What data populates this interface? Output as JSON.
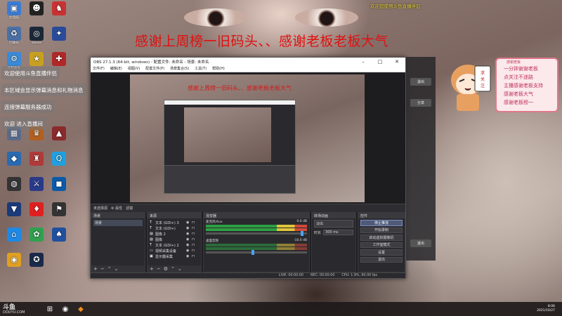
{
  "banner": "感谢上周榜一旧码头、、感谢老板老板大气",
  "notice": "欢迎您使用斗鱼直播伴侣",
  "chat_messages": [
    "欢迎使用斗鱼直播伴侣",
    "本区域会显示弹幕消息和礼物消息",
    "连接弹幕服务器成功",
    "欢迎 进入直播间"
  ],
  "desktop_icons": [
    {
      "label": "此电脑",
      "color": "#3a7bd5",
      "glyph": "▣"
    },
    {
      "label": "",
      "color": "#222",
      "glyph": "☻"
    },
    {
      "label": "",
      "color": "#c83232",
      "glyph": "♞"
    },
    {
      "label": "回收站",
      "color": "#4a6fa5",
      "glyph": "♻"
    },
    {
      "label": "Steam",
      "color": "#1b2838",
      "glyph": "◎"
    },
    {
      "label": "",
      "color": "#2a4a9a",
      "glyph": "✦"
    },
    {
      "label": "控制面板",
      "color": "#3a8ad6",
      "glyph": "⚙"
    },
    {
      "label": "",
      "color": "#c8a020",
      "glyph": "★"
    },
    {
      "label": "",
      "color": "#b02828",
      "glyph": "✚"
    },
    {
      "label": "",
      "color": "#5a6a8a",
      "glyph": "▦"
    },
    {
      "label": "",
      "color": "#b06020",
      "glyph": "♛"
    },
    {
      "label": "",
      "color": "#8a2a2a",
      "glyph": "▲"
    },
    {
      "label": "",
      "color": "#2a6ab0",
      "glyph": "◆"
    },
    {
      "label": "",
      "color": "#b03a3a",
      "glyph": "♜"
    },
    {
      "label": "",
      "color": "#20a0e0",
      "glyph": "Q"
    },
    {
      "label": "",
      "color": "#333",
      "glyph": "◍"
    },
    {
      "label": "",
      "color": "#2a3a8a",
      "glyph": "⚔"
    },
    {
      "label": "",
      "color": "#0a5aa8",
      "glyph": "◼"
    },
    {
      "label": "",
      "color": "#1a3a7a",
      "glyph": "▼"
    },
    {
      "label": "",
      "color": "#e02020",
      "glyph": "♦"
    },
    {
      "label": "",
      "color": "#333",
      "glyph": "⚑"
    },
    {
      "label": "",
      "color": "#1e88e5",
      "glyph": "⌂"
    },
    {
      "label": "",
      "color": "#30a050",
      "glyph": "✿"
    },
    {
      "label": "",
      "color": "#2050a0",
      "glyph": "♠"
    },
    {
      "label": "",
      "color": "#e0a020",
      "glyph": "◉"
    },
    {
      "label": "",
      "color": "#1a2a4a",
      "glyph": "✪"
    }
  ],
  "obs": {
    "title": "OBS 27.1.3 (64-bit, windows) - 配置文件: 未命名 - 场景: 未命名",
    "menu": [
      "文件(F)",
      "编辑(E)",
      "视图(V)",
      "配置文件(P)",
      "场景集合(S)",
      "工具(T)",
      "帮助(H)"
    ],
    "toolbar": [
      "未选择源",
      "⚙ 属性",
      "滤镜"
    ],
    "preview_banner": "感谢上周榜一旧码头、、感谢老板老板大气",
    "docks": {
      "scenes": {
        "title": "场景",
        "items": [
          "场景"
        ]
      },
      "sources": {
        "title": "来源",
        "items": [
          {
            "icon": "T",
            "label": "文本 (GDI+) 3"
          },
          {
            "icon": "T",
            "label": "文本 (GDI+)"
          },
          {
            "icon": "▨",
            "label": "图像 2"
          },
          {
            "icon": "▨",
            "label": "图像"
          },
          {
            "icon": "T",
            "label": "文本 (GDI+) 2"
          },
          {
            "icon": "▭",
            "label": "视频采集设备"
          },
          {
            "icon": "▣",
            "label": "显示器采集"
          }
        ]
      },
      "mixer": {
        "title": "混音器",
        "tracks": [
          {
            "name": "麦克风/Aux",
            "db": "0.0 dB"
          },
          {
            "name": "桌面音频",
            "db": "-10.0 dB"
          }
        ]
      },
      "transitions": {
        "title": "转场动画",
        "type": "淡出",
        "duration_label": "时长",
        "duration": "300 ms"
      },
      "controls": {
        "title": "控件",
        "buttons": [
          "停止推流",
          "开始录制",
          "启动虚拟摄像机",
          "工作室模式",
          "设置",
          "退出"
        ]
      }
    },
    "status": {
      "live": "LIVE: 00:00:00",
      "rec": "REC: 00:00:00",
      "cpu": "CPU: 1.9%, 60.00 fps"
    }
  },
  "right_app": {
    "buttons": [
      "退出",
      "分享",
      "退出"
    ]
  },
  "sign": {
    "title": "感谢老板",
    "lines": [
      "一分钟谢谢老板",
      "点关注不迷路",
      "主播感谢老板支持",
      "感谢老板大气",
      "感谢老板榜一"
    ]
  },
  "taskbar": {
    "time": "8:06",
    "date": "2021/10/27"
  },
  "watermark": {
    "brand": "斗鱼",
    "url": "DOUYU.COM"
  }
}
